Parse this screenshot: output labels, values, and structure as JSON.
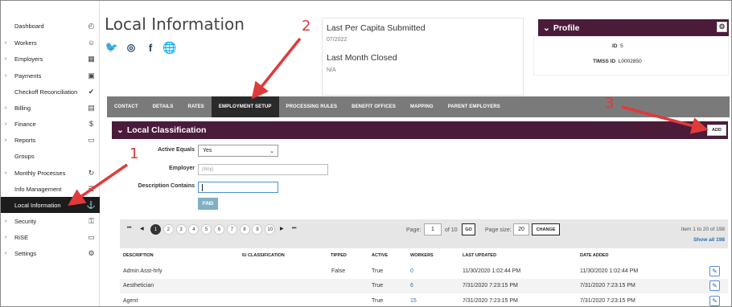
{
  "sidebar": {
    "items": [
      {
        "label": "Dashboard",
        "chevron": false,
        "icon": "◴",
        "icon_name": "gauge-icon",
        "active": false
      },
      {
        "label": "Workers",
        "chevron": true,
        "icon": "☺",
        "icon_name": "user-icon",
        "active": false
      },
      {
        "label": "Employers",
        "chevron": true,
        "icon": "▦",
        "icon_name": "building-icon",
        "active": false
      },
      {
        "label": "Payments",
        "chevron": true,
        "icon": "▣",
        "icon_name": "money-icon",
        "active": false
      },
      {
        "label": "Checkoff Reconciliation",
        "chevron": false,
        "icon": "✔",
        "icon_name": "check-double-icon",
        "active": false
      },
      {
        "label": "Billing",
        "chevron": true,
        "icon": "▤",
        "icon_name": "invoice-icon",
        "active": false
      },
      {
        "label": "Finance",
        "chevron": true,
        "icon": "$",
        "icon_name": "dollar-icon",
        "active": false
      },
      {
        "label": "Reports",
        "chevron": true,
        "icon": "▭",
        "icon_name": "reports-icon",
        "active": false
      },
      {
        "label": "Groups",
        "chevron": false,
        "icon": "",
        "icon_name": "",
        "active": false
      },
      {
        "label": "Monthly Processes",
        "chevron": true,
        "icon": "↻",
        "icon_name": "cycle-icon",
        "active": false
      },
      {
        "label": "Info Management",
        "chevron": false,
        "icon": "☰",
        "icon_name": "list-icon",
        "active": false
      },
      {
        "label": "Local Information",
        "chevron": false,
        "icon": "⚓",
        "icon_name": "anchor-icon",
        "active": true
      },
      {
        "label": "Security",
        "chevron": true,
        "icon": "⚿",
        "icon_name": "key-icon",
        "active": false
      },
      {
        "label": "RiSE",
        "chevron": true,
        "icon": "▭",
        "icon_name": "monitor-icon",
        "active": false
      },
      {
        "label": "Settings",
        "chevron": true,
        "icon": "⚙",
        "icon_name": "gear-icon",
        "active": false
      }
    ]
  },
  "header": {
    "title": "Local Information",
    "social": [
      "twitter-icon",
      "instagram-icon",
      "facebook-icon",
      "globe-icon"
    ]
  },
  "summary": {
    "per_capita_label": "Last Per Capita Submitted",
    "per_capita_value": "07/2022",
    "month_closed_label": "Last Month Closed",
    "month_closed_value": "N/A"
  },
  "profile": {
    "title": "Profile",
    "id_label": "ID",
    "id_value": "5",
    "timss_label": "TIMSS ID",
    "timss_value": "L0002850"
  },
  "tabs": [
    "CONTACT",
    "DETAILS",
    "RATES",
    "EMPLOYMENT SETUP",
    "PROCESSING RULES",
    "BENEFIT OFFICES",
    "MAPPING",
    "PARENT EMPLOYERS"
  ],
  "active_tab": "EMPLOYMENT SETUP",
  "classification": {
    "title": "Local Classification",
    "add_label": "ADD",
    "active_equals_label": "Active Equals",
    "active_equals_value": "Yes",
    "employer_label": "Employer",
    "employer_placeholder": "(Any)",
    "description_label": "Description Contains",
    "description_value": "",
    "find_label": "FIND"
  },
  "pager": {
    "pages": [
      "1",
      "2",
      "3",
      "4",
      "5",
      "6",
      "7",
      "8",
      "9",
      "10"
    ],
    "current_page": "1",
    "page_label": "Page:",
    "page_value": "1",
    "of_label": "of 10",
    "go_label": "GO",
    "size_label": "Page size:",
    "size_value": "20",
    "change_label": "CHANGE",
    "item_info": "Item 1 to 20 of 198",
    "show_all": "Show all 198"
  },
  "grid": {
    "columns": [
      "DESCRIPTION",
      "IU CLASSIFICATION",
      "TIPPED",
      "ACTIVE",
      "WORKERS",
      "LAST UPDATED",
      "DATE ADDED"
    ],
    "rows": [
      {
        "description": "Admin Asst-hrly",
        "iu": "",
        "tipped": "False",
        "active": "True",
        "workers": "0",
        "updated": "11/30/2020 1:02:44 PM",
        "added": "11/30/2020 1:02:44 PM"
      },
      {
        "description": "Aesthetician",
        "iu": "",
        "tipped": "",
        "active": "True",
        "workers": "6",
        "updated": "7/31/2020 7:23:15 PM",
        "added": "7/31/2020 7:23:15 PM"
      },
      {
        "description": "Agent",
        "iu": "",
        "tipped": "",
        "active": "True",
        "workers": "15",
        "updated": "7/31/2020 7:23:15 PM",
        "added": "7/31/2020 7:23:15 PM"
      }
    ]
  },
  "annotations": [
    "1",
    "2",
    "3"
  ],
  "colors": {
    "brand": "#4a1c3a",
    "tab_bar": "#7a7a7a",
    "annotation": "#e03a3a",
    "link": "#2a6fb5"
  }
}
